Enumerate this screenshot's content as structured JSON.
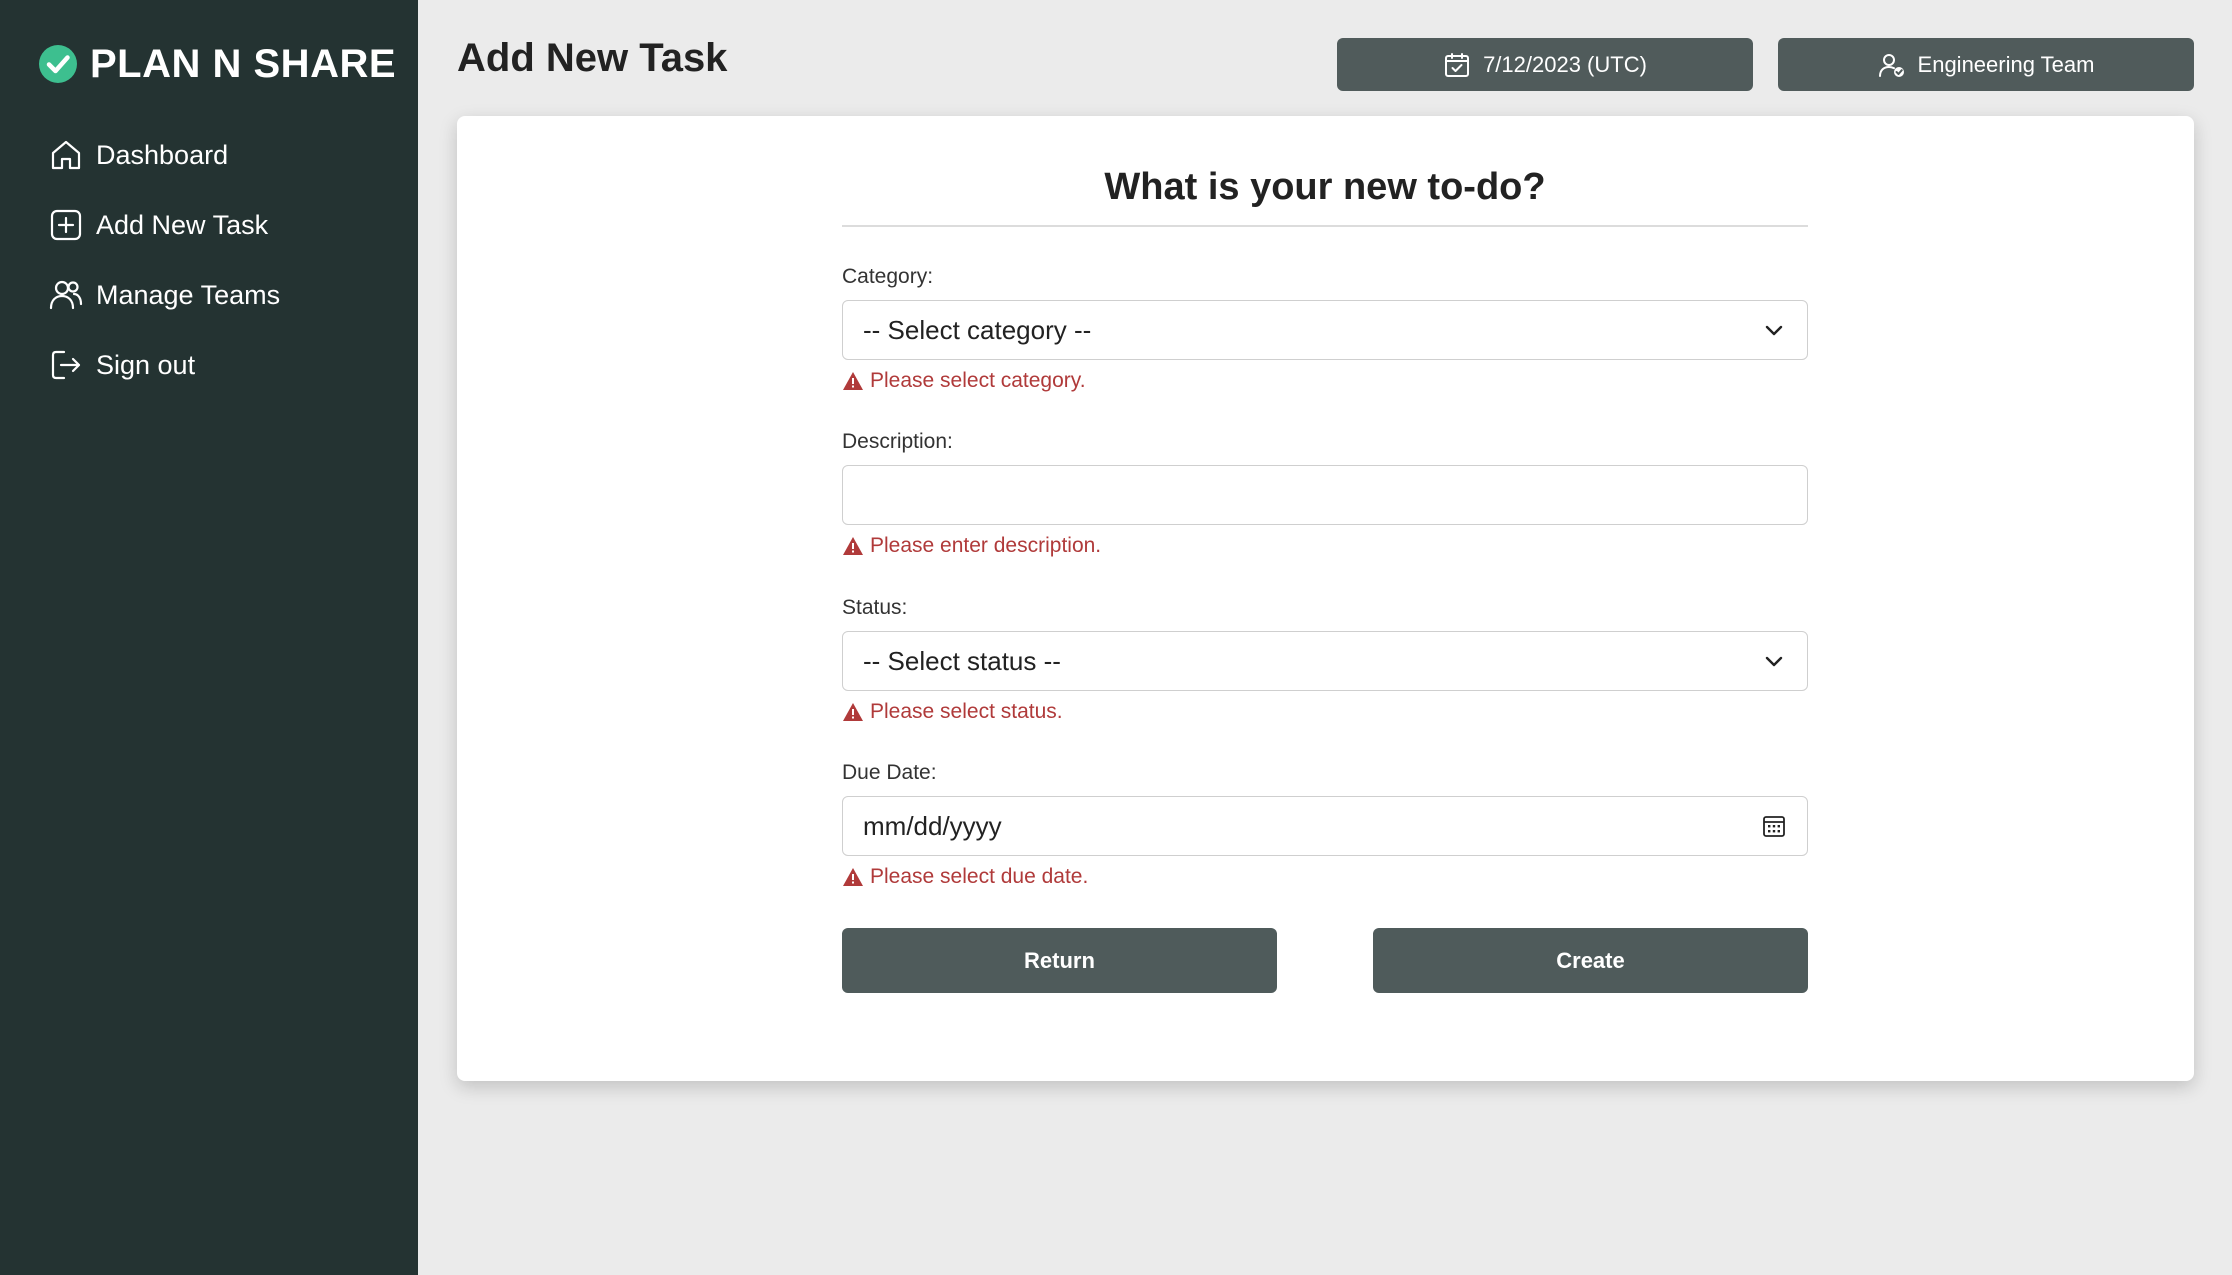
{
  "app": {
    "brand": "PLAN N SHARE",
    "page_title": "Add New Task"
  },
  "sidebar": {
    "items": [
      {
        "label": "Dashboard",
        "icon": "home-icon"
      },
      {
        "label": "Add New Task",
        "icon": "plus-square-icon"
      },
      {
        "label": "Manage Teams",
        "icon": "users-icon"
      },
      {
        "label": "Sign out",
        "icon": "sign-out-icon"
      }
    ]
  },
  "header": {
    "date_label": "7/12/2023 (UTC)",
    "team_label": "Engineering Team"
  },
  "form": {
    "title": "What is your new to-do?",
    "category": {
      "label": "Category:",
      "value": "-- Select category --",
      "error": "Please select category."
    },
    "description": {
      "label": "Description:",
      "value": "",
      "error": "Please enter description."
    },
    "status": {
      "label": "Status:",
      "value": "-- Select status --",
      "error": "Please select status."
    },
    "due_date": {
      "label": "Due Date:",
      "placeholder": "mm/dd/yyyy",
      "error": "Please select due date."
    },
    "return_label": "Return",
    "create_label": "Create"
  },
  "colors": {
    "sidebar_bg": "#243332",
    "accent_check": "#3dbf8f",
    "button_bg": "#4f5b5b",
    "error": "#b03a3a"
  }
}
